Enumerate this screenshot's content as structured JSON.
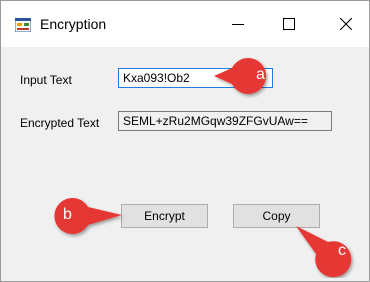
{
  "window": {
    "title": "Encryption",
    "icon": "app-form-icon",
    "controls": {
      "minimize": "minimize-icon",
      "maximize": "maximize-icon",
      "close": "close-icon"
    }
  },
  "form": {
    "input_label": "Input Text",
    "input_value": "Kxa093!Ob2",
    "encrypted_label": "Encrypted Text",
    "encrypted_value": "SEML+zRu2MGqw39ZFGvUAw=="
  },
  "buttons": {
    "encrypt_label": "Encrypt",
    "copy_label": "Copy"
  },
  "annotations": {
    "a": "a",
    "b": "b",
    "c": "c",
    "color": "#e53935"
  }
}
